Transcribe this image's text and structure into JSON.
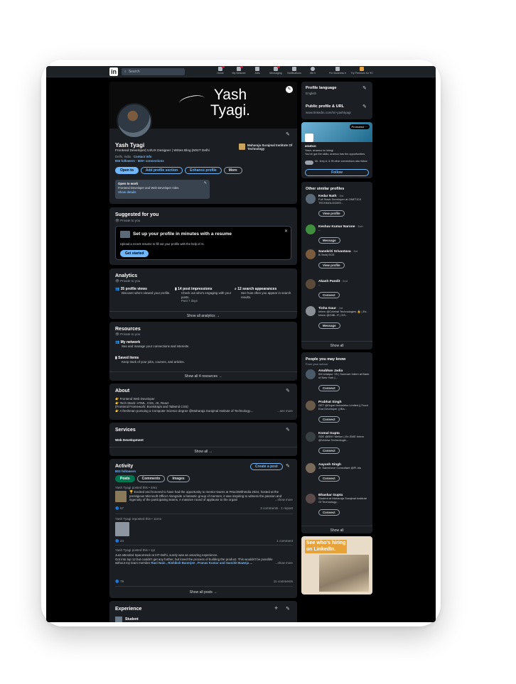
{
  "topbar": {
    "logo": "in",
    "search_placeholder": "Search",
    "nav": [
      {
        "label": "Home",
        "icon": "home-icon",
        "badge": true
      },
      {
        "label": "My Network",
        "icon": "network-icon",
        "badge": true
      },
      {
        "label": "Jobs",
        "icon": "jobs-icon",
        "badge": false
      },
      {
        "label": "Messaging",
        "icon": "messaging-icon",
        "badge": true
      },
      {
        "label": "Notifications",
        "icon": "bell-icon",
        "badge": false
      },
      {
        "label": "Me ▾",
        "icon": "me-icon",
        "badge": false
      },
      {
        "label": "For Business ▾",
        "icon": "grid-icon",
        "badge": false
      },
      {
        "label": "Try Premium for ₹0",
        "icon": "premium-icon",
        "badge": false
      }
    ]
  },
  "profile": {
    "banner_line1": "Yash",
    "banner_line2": "Tyagi.",
    "name": "Yash Tyagi",
    "headline": "Frontend Developer| UI/UX Designer | Writes Blog |MSIT Delhi",
    "location": "Delhi, India",
    "contact": "Contact info",
    "stats": "803 followers · 500+ connections",
    "school": "Maharaja Surajmal Institute Of Technology",
    "buttons": [
      "Open to",
      "Add profile section",
      "Enhance profile",
      "More"
    ],
    "open_to_work_title": "Open to work",
    "open_to_work_text": "Frontend Developer and Web Developer roles",
    "open_to_work_link": "Show details"
  },
  "suggested": {
    "title": "Suggested for you",
    "private": "Private to you",
    "card_title": "Set up your profile in minutes with a resume",
    "card_text": "Upload a recent resume to fill out your profile with the help of AI.",
    "button": "Get started"
  },
  "analytics": {
    "title": "Analytics",
    "private": "Private to you",
    "items": [
      {
        "title": "35 profile views",
        "text": "Discover who's viewed your profile."
      },
      {
        "title": "14 post impressions",
        "text": "Check out who's engaging with your posts.",
        "note": "Past 7 days"
      },
      {
        "title": "12 search appearances",
        "text": "See how often you appear in search results."
      }
    ],
    "show_all": "Show all analytics →"
  },
  "resources": {
    "title": "Resources",
    "private": "Private to you",
    "items": [
      {
        "title": "My network",
        "text": "See and manage your connections and interests."
      },
      {
        "title": "Saved items",
        "text": "Keep track of your jobs, courses, and articles."
      }
    ],
    "show_all": "Show all 4 resources →"
  },
  "about": {
    "title": "About",
    "lines": [
      "👉 Frontend Web Developer",
      "👉 Tech Stack: HTML, CSS, JS, React",
      "(Frontend Framework: Bootstrap5 and Tailwind CSS)",
      "👉 A freshman pursuing a Computer Science degree @Maharaja Surajmal Institute of Technology...."
    ],
    "see_more": "...see more"
  },
  "services": {
    "title": "Services",
    "text": "Web Development",
    "show_all": "Show all →"
  },
  "activity": {
    "title": "Activity",
    "followers": "803 followers",
    "create_post": "Create a post",
    "tabs": [
      "Posts",
      "Comments",
      "Images"
    ],
    "posts": [
      {
        "meta": "Yash Tyagi posted this • 4mo",
        "text": "🏆 Excited and honored to have had the opportunity to mentor teams at #HackWithIndia 2024, hosted at the prestigious Microsoft Office! Alongside a fantastic group of mentors, it was inspiring to witness the passion and ingenuity of the participating teams. A massive round of applause to the organi",
        "more": "...show more",
        "reactions": "67",
        "stats": "3 comments · 1 repost"
      },
      {
        "meta": "Yash Tyagi reposted this • 11mo",
        "reactions": "24",
        "stats": "1 comment"
      },
      {
        "meta": "Yash Tyagi posted this • 1yr",
        "text1": "Just attended SpaceHack at IIIT-Delhi, surely was an amazing experience.",
        "text2": "Got into top 12 but couldn't get any further, but loved the process of building the product. This wouldn't be possible",
        "text3_prefix": "without my team member",
        "text3_names": "Ravi Nain , Rishiksh Banerjee , Pranav Kumar and Sanchit Baweja ...",
        "more": "...show more",
        "reactions": "79",
        "stats": "11 comments"
      }
    ],
    "show_all": "Show all posts →"
  },
  "experience": {
    "title": "Experience",
    "item": "Student"
  },
  "sidebar": {
    "profile_language": "Profile language",
    "language": "English",
    "public_profile": "Public profile & URL",
    "url": "www.linkedin.com/in/-yashtyagi",
    "ad": {
      "promoted": "Promoted ···",
      "company": "aramco",
      "line1": "Yash, aramco is hiring!",
      "line2": "You've got the skills, aramco has the opportunities.",
      "line3": "Mr. Jerry A. & 99 other connections also follow",
      "button": "Follow"
    },
    "similar": {
      "title": "Other similar profiles",
      "people": [
        {
          "name": "Kedar Nath",
          "degree": "· 3rd",
          "text": "Full Stack Developer at ONETICK TECHNOLOGIES...",
          "button": "View profile"
        },
        {
          "name": "Keshav Kumar Narone",
          "degree": "· 3rd+",
          "text": "--",
          "button": "Message"
        },
        {
          "name": "Sanskriti Srivastava",
          "degree": "· 3rd",
          "text": "B.Tech| ECE",
          "button": "View profile"
        },
        {
          "name": "Akash Pandit",
          "degree": "· 2nd",
          "text": "--",
          "button": "Connect"
        },
        {
          "name": "Tisha Gaur",
          "degree": "· 1st",
          "text": "Intern @Celebal Technologies 🔒 | Ex-Intern @GIBL.IT | DS...",
          "button": "Message"
        }
      ],
      "show_all": "Show all"
    },
    "pymk": {
      "title": "People you may know",
      "subtitle": "From your school",
      "people": [
        {
          "name": "Anubhav Jadia",
          "text": "IIM Udaipur '25 | Summer Intern at Bank of New York |..."
        },
        {
          "name": "Prabhat Singh",
          "text": "GET @Dujari Industries Limited || Front End Developer || Bla..."
        },
        {
          "name": "Komal Gupta",
          "text": "SDE @BNY Mellon | Ex-SWE Intern @Veersa Technologie..."
        },
        {
          "name": "Aayush Singh",
          "text": "Jr. Salesforce Consultant @PI-ido"
        },
        {
          "name": "Bhaskar Gupta",
          "text": "Student at Maharaja Surajmal Institute Of Technology..."
        }
      ],
      "connect": "Connect",
      "show_all": "Show all"
    },
    "hiring": {
      "line1": "See who's hiring",
      "line2": "on LinkedIn."
    }
  }
}
